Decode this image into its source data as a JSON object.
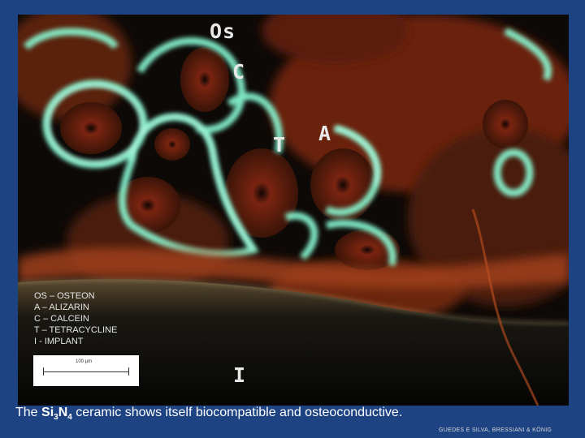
{
  "labels": {
    "os": "Os",
    "c": "C",
    "t": "T",
    "a": "A",
    "i": "I"
  },
  "legend": [
    "OS – OSTEON",
    "A – ALIZARIN",
    "C – CALCEIN",
    "T – TETRACYCLINE",
    "I - IMPLANT"
  ],
  "scale_bar": {
    "text": "100 µm"
  },
  "caption": {
    "prefix": "The ",
    "si": "Si",
    "si_sub": "3",
    "n": "N",
    "n_sub": "4",
    "rest": " ceramic shows itself biocompatible and osteoconductive."
  },
  "credit": "GUEDES E SILVA, BRESSIANI & KÖNIG",
  "colors": {
    "slide_background": "#1e4382",
    "calcein_green": "#7fffd0",
    "alizarin_red": "#8a2a10",
    "text_white": "#ffffff"
  }
}
